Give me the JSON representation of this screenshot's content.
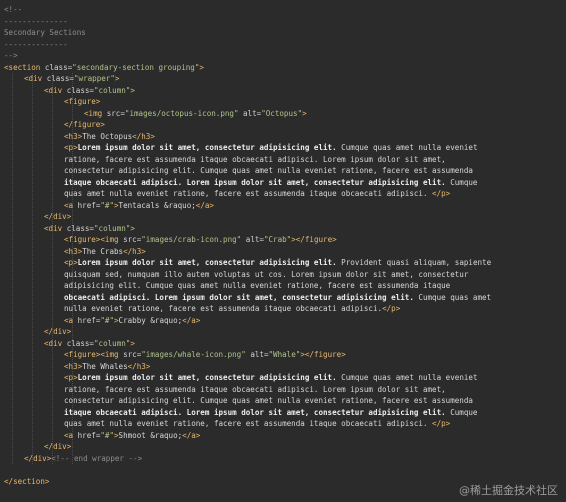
{
  "editor": {
    "background": "#2b2b2b",
    "colors": {
      "tag": "#e9b96e",
      "attribute": "#d3d3d3",
      "string": "#b0c48a",
      "text": "#d7d7d7",
      "comment": "#8d8d8d"
    },
    "lines": [
      {
        "indent": 0,
        "tokens": [
          {
            "text": "<!--",
            "kind": "comment"
          }
        ]
      },
      {
        "indent": 0,
        "tokens": [
          {
            "text": "--------------",
            "kind": "comment"
          }
        ]
      },
      {
        "indent": 0,
        "tokens": [
          {
            "text": "Secondary Sections",
            "kind": "comment"
          }
        ]
      },
      {
        "indent": 0,
        "tokens": [
          {
            "text": "--------------",
            "kind": "comment"
          }
        ]
      },
      {
        "indent": 0,
        "tokens": [
          {
            "text": "-->",
            "kind": "comment"
          }
        ]
      },
      {
        "indent": 0,
        "tokens": [
          {
            "text": "<section ",
            "kind": "tag"
          },
          {
            "text": "class=",
            "kind": "attr"
          },
          {
            "text": "\"secondary-section grouping\"",
            "kind": "str"
          },
          {
            "text": ">",
            "kind": "tag"
          }
        ]
      },
      {
        "indent": 1,
        "tokens": [
          {
            "text": "<div ",
            "kind": "tag"
          },
          {
            "text": "class=",
            "kind": "attr"
          },
          {
            "text": "\"wrapper\"",
            "kind": "str"
          },
          {
            "text": ">",
            "kind": "tag"
          }
        ]
      },
      {
        "indent": 2,
        "tokens": [
          {
            "text": "<div ",
            "kind": "tag"
          },
          {
            "text": "class=",
            "kind": "attr"
          },
          {
            "text": "\"column\"",
            "kind": "str"
          },
          {
            "text": ">",
            "kind": "tag"
          }
        ]
      },
      {
        "indent": 3,
        "tokens": [
          {
            "text": "<figure>",
            "kind": "tag"
          }
        ]
      },
      {
        "indent": 4,
        "tokens": [
          {
            "text": "<img ",
            "kind": "tag"
          },
          {
            "text": "src=",
            "kind": "attr"
          },
          {
            "text": "\"images/octopus-icon.png\"",
            "kind": "str"
          },
          {
            "text": " alt=",
            "kind": "attr"
          },
          {
            "text": "\"Octopus\"",
            "kind": "str"
          },
          {
            "text": ">",
            "kind": "tag"
          }
        ]
      },
      {
        "indent": 3,
        "tokens": [
          {
            "text": "</figure>",
            "kind": "tag"
          }
        ]
      },
      {
        "indent": 3,
        "tokens": [
          {
            "text": "<h3>",
            "kind": "tag"
          },
          {
            "text": "The Octopus",
            "kind": "text"
          },
          {
            "text": "</h3>",
            "kind": "tag"
          }
        ]
      },
      {
        "indent": 3,
        "tokens": [
          {
            "text": "<p>",
            "kind": "tag"
          },
          {
            "text": "Lorem ipsum dolor sit amet, consectetur adipisicing elit.",
            "kind": "bold"
          },
          {
            "text": " Cumque quas amet nulla eveniet",
            "kind": "text"
          }
        ]
      },
      {
        "indent": 3,
        "tokens": [
          {
            "text": "ratione, facere est assumenda itaque obcaecati adipisci. Lorem ipsum dolor sit amet,",
            "kind": "text"
          }
        ]
      },
      {
        "indent": 3,
        "tokens": [
          {
            "text": "consectetur adipisicing elit. Cumque quas amet nulla eveniet ratione, facere est assumenda",
            "kind": "text"
          }
        ]
      },
      {
        "indent": 3,
        "tokens": [
          {
            "text": "itaque obcaecati adipisci. Lorem ipsum dolor sit amet, consectetur adipisicing elit.",
            "kind": "bold"
          },
          {
            "text": " Cumque",
            "kind": "text"
          }
        ]
      },
      {
        "indent": 3,
        "tokens": [
          {
            "text": "quas amet nulla eveniet ratione, facere est assumenda itaque obcaecati adipisci. ",
            "kind": "text"
          },
          {
            "text": "</p>",
            "kind": "tag"
          }
        ]
      },
      {
        "indent": 3,
        "tokens": [
          {
            "text": "<a ",
            "kind": "tag"
          },
          {
            "text": "href=",
            "kind": "attr"
          },
          {
            "text": "\"#\"",
            "kind": "str"
          },
          {
            "text": ">",
            "kind": "tag"
          },
          {
            "text": "Tentacals &raquo;",
            "kind": "text"
          },
          {
            "text": "</a>",
            "kind": "tag"
          }
        ]
      },
      {
        "indent": 2,
        "tokens": [
          {
            "text": "</div>",
            "kind": "tag"
          }
        ]
      },
      {
        "indent": 2,
        "tokens": [
          {
            "text": "<div ",
            "kind": "tag"
          },
          {
            "text": "class=",
            "kind": "attr"
          },
          {
            "text": "\"column\"",
            "kind": "str"
          },
          {
            "text": ">",
            "kind": "tag"
          }
        ]
      },
      {
        "indent": 3,
        "tokens": [
          {
            "text": "<figure>",
            "kind": "tag"
          },
          {
            "text": "<img ",
            "kind": "tag"
          },
          {
            "text": "src=",
            "kind": "attr"
          },
          {
            "text": "\"images/crab-icon.png\"",
            "kind": "str"
          },
          {
            "text": " alt=",
            "kind": "attr"
          },
          {
            "text": "\"Crab\"",
            "kind": "str"
          },
          {
            "text": ">",
            "kind": "tag"
          },
          {
            "text": "</figure>",
            "kind": "tag"
          }
        ]
      },
      {
        "indent": 3,
        "tokens": [
          {
            "text": "<h3>",
            "kind": "tag"
          },
          {
            "text": "The Crabs",
            "kind": "text"
          },
          {
            "text": "</h3>",
            "kind": "tag"
          }
        ]
      },
      {
        "indent": 3,
        "tokens": [
          {
            "text": "<p>",
            "kind": "tag"
          },
          {
            "text": "Lorem ipsum dolor sit amet, consectetur adipisicing elit.",
            "kind": "bold"
          },
          {
            "text": " Provident quasi aliquam, sapiente",
            "kind": "text"
          }
        ]
      },
      {
        "indent": 3,
        "tokens": [
          {
            "text": "quisquam sed, numquam illo autem voluptas ut cos. Lorem ipsum dolor sit amet, consectetur",
            "kind": "text"
          }
        ]
      },
      {
        "indent": 3,
        "tokens": [
          {
            "text": "adipisicing elit. Cumque quas amet nulla eveniet ratione, facere est assumenda itaque",
            "kind": "text"
          }
        ]
      },
      {
        "indent": 3,
        "tokens": [
          {
            "text": "obcaecati adipisci. Lorem ipsum dolor sit amet, consectetur adipisicing elit.",
            "kind": "bold"
          },
          {
            "text": " Cumque quas amet",
            "kind": "text"
          }
        ]
      },
      {
        "indent": 3,
        "tokens": [
          {
            "text": "nulla eveniet ratione, facere est assumenda itaque obcaecati adipisci.",
            "kind": "text"
          },
          {
            "text": "</p>",
            "kind": "tag"
          }
        ]
      },
      {
        "indent": 3,
        "tokens": [
          {
            "text": "<a ",
            "kind": "tag"
          },
          {
            "text": "href=",
            "kind": "attr"
          },
          {
            "text": "\"#\"",
            "kind": "str"
          },
          {
            "text": ">",
            "kind": "tag"
          },
          {
            "text": "Crabby &raquo;",
            "kind": "text"
          },
          {
            "text": "</a>",
            "kind": "tag"
          }
        ]
      },
      {
        "indent": 2,
        "tokens": [
          {
            "text": "</div>",
            "kind": "tag"
          }
        ]
      },
      {
        "indent": 2,
        "tokens": [
          {
            "text": "<div ",
            "kind": "tag"
          },
          {
            "text": "class=",
            "kind": "attr"
          },
          {
            "text": "\"column\"",
            "kind": "str"
          },
          {
            "text": ">",
            "kind": "tag"
          }
        ]
      },
      {
        "indent": 3,
        "tokens": [
          {
            "text": "<figure>",
            "kind": "tag"
          },
          {
            "text": "<img ",
            "kind": "tag"
          },
          {
            "text": "src=",
            "kind": "attr"
          },
          {
            "text": "\"images/whale-icon.png\"",
            "kind": "str"
          },
          {
            "text": " alt=",
            "kind": "attr"
          },
          {
            "text": "\"Whale\"",
            "kind": "str"
          },
          {
            "text": ">",
            "kind": "tag"
          },
          {
            "text": "</figure>",
            "kind": "tag"
          }
        ]
      },
      {
        "indent": 3,
        "tokens": [
          {
            "text": "<h3>",
            "kind": "tag"
          },
          {
            "text": "The Whales",
            "kind": "text"
          },
          {
            "text": "</h3>",
            "kind": "tag"
          }
        ]
      },
      {
        "indent": 3,
        "tokens": [
          {
            "text": "<p>",
            "kind": "tag"
          },
          {
            "text": "Lorem ipsum dolor sit amet, consectetur adipisicing elit.",
            "kind": "bold"
          },
          {
            "text": " Cumque quas amet nulla eveniet",
            "kind": "text"
          }
        ]
      },
      {
        "indent": 3,
        "tokens": [
          {
            "text": "ratione, facere est assumenda itaque obcaecati adipisci. Lorem ipsum dolor sit amet,",
            "kind": "text"
          }
        ]
      },
      {
        "indent": 3,
        "tokens": [
          {
            "text": "consectetur adipisicing elit. Cumque quas amet nulla eveniet ratione, facere est assumenda",
            "kind": "text"
          }
        ]
      },
      {
        "indent": 3,
        "tokens": [
          {
            "text": "itaque obcaecati adipisci. Lorem ipsum dolor sit amet, consectetur adipisicing elit.",
            "kind": "bold"
          },
          {
            "text": " Cumque",
            "kind": "text"
          }
        ]
      },
      {
        "indent": 3,
        "tokens": [
          {
            "text": "quas amet nulla eveniet ratione, facere est assumenda itaque obcaecati adipisci. ",
            "kind": "text"
          },
          {
            "text": "</p>",
            "kind": "tag"
          }
        ]
      },
      {
        "indent": 3,
        "tokens": [
          {
            "text": "<a ",
            "kind": "tag"
          },
          {
            "text": "href=",
            "kind": "attr"
          },
          {
            "text": "\"#\"",
            "kind": "str"
          },
          {
            "text": ">",
            "kind": "tag"
          },
          {
            "text": "Shmoot &raquo;",
            "kind": "text"
          },
          {
            "text": "</a>",
            "kind": "tag"
          }
        ]
      },
      {
        "indent": 2,
        "tokens": [
          {
            "text": "</div>",
            "kind": "tag"
          }
        ]
      },
      {
        "indent": 1,
        "tokens": [
          {
            "text": "</div>",
            "kind": "tag"
          },
          {
            "text": "<!-- end wrapper -->",
            "kind": "comment"
          }
        ]
      },
      {
        "indent": 0,
        "tokens": [
          {
            "text": "",
            "kind": "text"
          }
        ]
      },
      {
        "indent": 0,
        "tokens": [
          {
            "text": "</section>",
            "kind": "tag"
          }
        ]
      }
    ]
  },
  "watermark": "@稀土掘金技术社区"
}
